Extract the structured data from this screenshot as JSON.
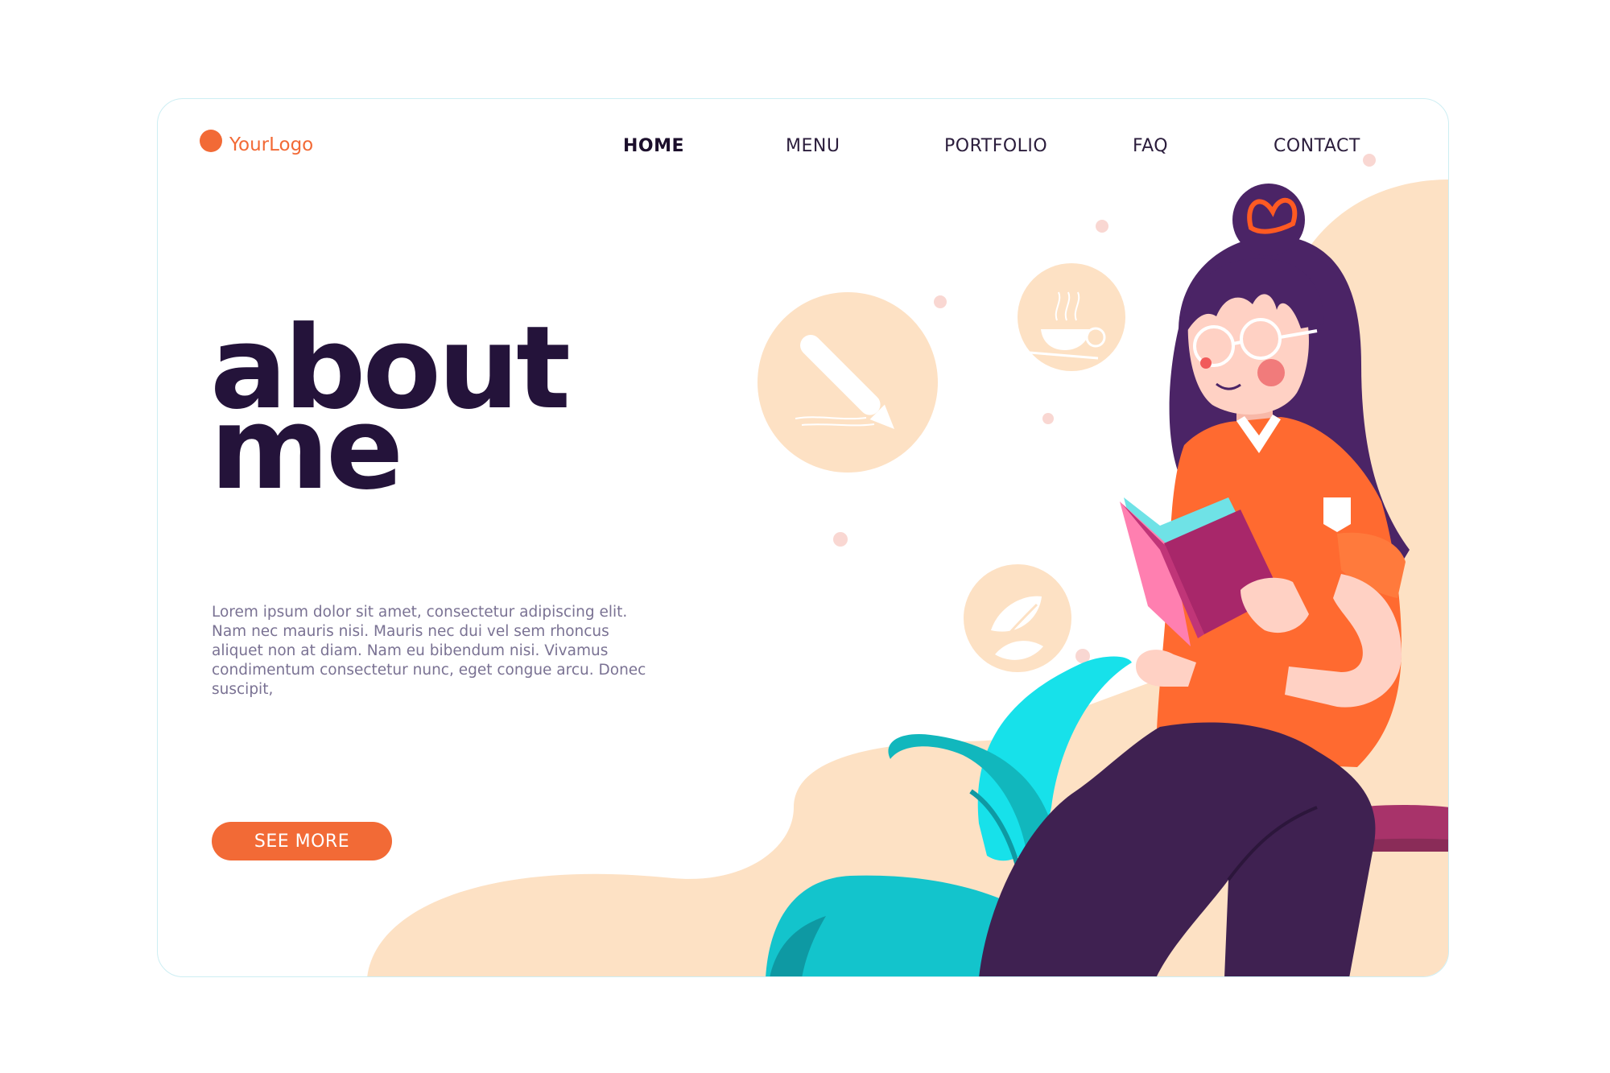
{
  "brand": {
    "logo_text": "YourLogo",
    "accent": "#f26a36"
  },
  "nav": {
    "items": [
      {
        "label": "HOME",
        "active": true
      },
      {
        "label": "MENU",
        "active": false
      },
      {
        "label": "PORTFOLIO",
        "active": false
      },
      {
        "label": "FAQ",
        "active": false
      },
      {
        "label": "CONTACT",
        "active": false
      }
    ]
  },
  "hero": {
    "title_line1": "about",
    "title_line2": "me",
    "body": "Lorem ipsum dolor sit amet, consectetur adipiscing elit. Nam nec mauris nisi. Mauris nec dui vel sem rhoncus aliquet non at diam. Nam eu bibendum nisi. Vivamus condimentum consectetur nunc, eget congue arcu. Donec suscipit,",
    "cta_label": "SEE MORE"
  },
  "illustration": {
    "subject": "woman-reading-book-icon",
    "icons": [
      "pencil-icon",
      "coffee-cup-icon",
      "leaf-icon"
    ]
  },
  "colors": {
    "title": "#24133a",
    "body_text": "#7a7293",
    "peach": "#fde1c4",
    "shirt": "#ff6a30",
    "hair": "#4b2466",
    "pants": "#3f2151",
    "book": "#a8276a",
    "plant": "#17c3cf"
  }
}
